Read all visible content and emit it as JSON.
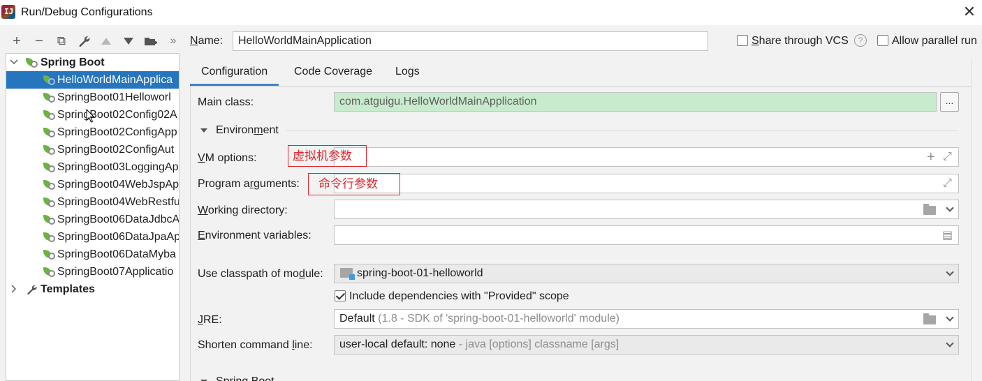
{
  "window": {
    "title": "Run/Debug Configurations",
    "close_glyph": "✕",
    "app_icon_text": "IJ"
  },
  "toolbar": [
    {
      "name": "add",
      "glyph": "+"
    },
    {
      "name": "remove",
      "glyph": "−"
    },
    {
      "name": "copy",
      "glyph": "⧉"
    },
    {
      "name": "edit-defaults",
      "glyph": "🔧"
    },
    {
      "name": "move-up",
      "glyph": "▲"
    },
    {
      "name": "move-down",
      "glyph": "▼"
    },
    {
      "name": "move-to-folder",
      "glyph": "📁"
    },
    {
      "name": "more",
      "glyph": "»"
    }
  ],
  "tree": {
    "group": "Spring Boot",
    "items": [
      "HelloWorldMainApplica",
      "SpringBoot01Helloworl",
      "SpringBoot02Config02A",
      "SpringBoot02ConfigApp",
      "SpringBoot02ConfigAut",
      "SpringBoot03LoggingAp",
      "SpringBoot04WebJspAp",
      "SpringBoot04WebRestfu",
      "SpringBoot06DataJdbcA",
      "SpringBoot06DataJpaAp",
      "SpringBoot06DataMyba",
      "SpringBoot07Applicatio"
    ],
    "templates": "Templates"
  },
  "header": {
    "name_label_pre": "",
    "name_label_u": "N",
    "name_label_post": "ame:",
    "name_value": "HelloWorldMainApplication",
    "share_pre": "",
    "share_u": "S",
    "share_post": "hare through VCS",
    "help_glyph": "?",
    "allow_parallel": "Allow parallel run"
  },
  "tabs": [
    "Configuration",
    "Code Coverage",
    "Logs"
  ],
  "form": {
    "main_class_label": "Main class:",
    "main_class_value": "com.atguigu.HelloWorldMainApplication",
    "browse_glyph": "...",
    "environment_pre": "Environ",
    "environment_u": "m",
    "environment_post": "ent",
    "vm_options_pre": "",
    "vm_options_u": "V",
    "vm_options_post": "M options:",
    "program_args_pre": "Program a",
    "program_args_u": "r",
    "program_args_post": "guments:",
    "working_dir_pre": "",
    "working_dir_u": "W",
    "working_dir_post": "orking directory:",
    "env_vars_pre": "",
    "env_vars_u": "E",
    "env_vars_post": "nvironment variables:",
    "classpath_pre": "Use classpath of mo",
    "classpath_u": "d",
    "classpath_post": "ule:",
    "classpath_value": "spring-boot-01-helloworld",
    "include_deps": "Include dependencies with \"Provided\" scope",
    "jre_pre": "",
    "jre_u": "J",
    "jre_post": "RE:",
    "jre_value": "Default",
    "jre_hint": "(1.8 - SDK of 'spring-boot-01-helloworld' module)",
    "shorten_pre": "Shorten command ",
    "shorten_u": "l",
    "shorten_post": "ine:",
    "shorten_value": "user-local default: none",
    "shorten_hint": "- java [options] classname [args]",
    "next_section": "Spring Boot",
    "plus_glyph": "+",
    "expand_glyph": "⤢",
    "doc_glyph": "▤"
  },
  "annotations": {
    "vm": "虚拟机参数",
    "program": "命令行参数",
    "color": "#e0262e"
  },
  "colors": {
    "selection": "#2675bf",
    "main_class_bg": "#c9ebcd",
    "tab_accent": "#4083c9",
    "spring_green": "#6db33f"
  }
}
